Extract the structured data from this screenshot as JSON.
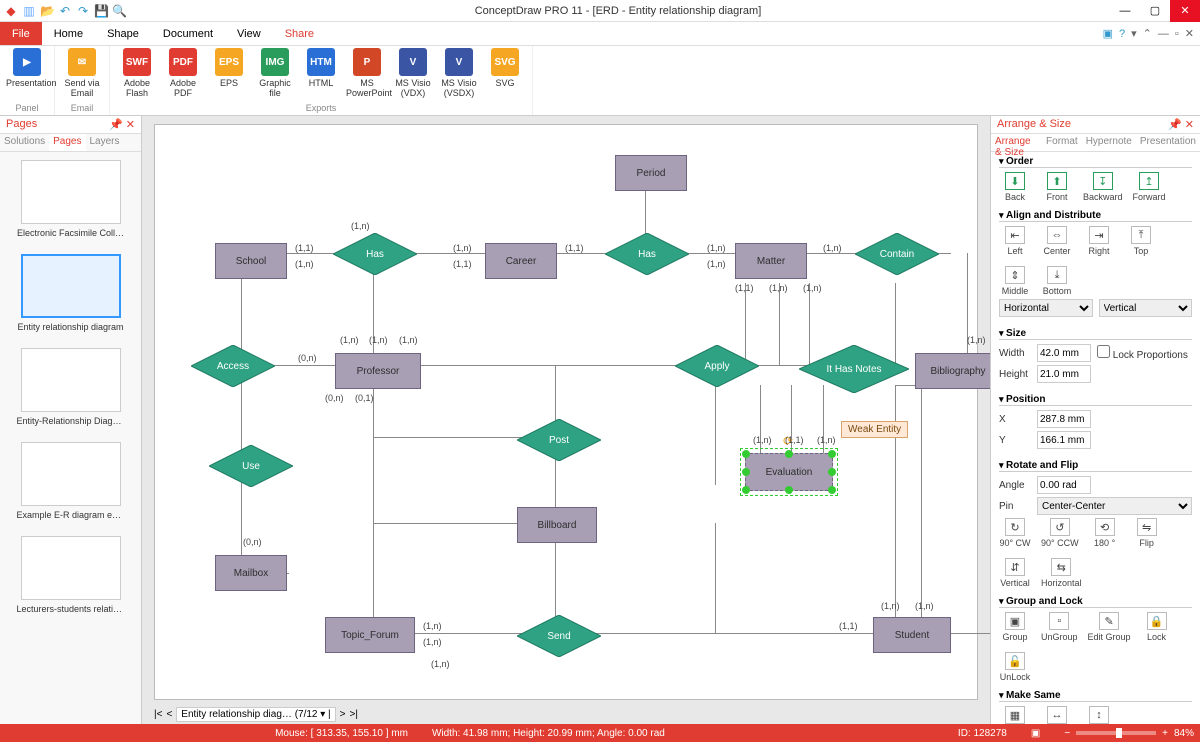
{
  "title": "ConceptDraw PRO 11 - [ERD - Entity relationship diagram]",
  "menu": {
    "file": "File",
    "home": "Home",
    "shape": "Shape",
    "document": "Document",
    "view": "View",
    "share": "Share"
  },
  "ribbon": {
    "groups": {
      "panel": "Panel",
      "email": "Email",
      "exports": "Exports"
    },
    "cmds": {
      "presentation": "Presentation",
      "send_email": "Send via Email",
      "adobe_flash": "Adobe Flash",
      "adobe_pdf": "Adobe PDF",
      "eps": "EPS",
      "graphic": "Graphic file",
      "html": "HTML",
      "ms_ppt": "MS PowerPoint",
      "visio_vdx": "MS Visio (VDX)",
      "visio_vsdx": "MS Visio (VSDX)",
      "svg": "SVG"
    }
  },
  "pages": {
    "header": "Pages",
    "tabs": {
      "solutions": "Solutions",
      "pages": "Pages",
      "layers": "Layers"
    },
    "items": [
      "Electronic Facsimile Coll…",
      "Entity relationship diagram",
      "Entity-Relationship Diagr…",
      "Example E-R diagram ext…",
      "Lecturers-students relatio…"
    ]
  },
  "diagram": {
    "entities": {
      "period": "Period",
      "school": "School",
      "career": "Career",
      "matter": "Matter",
      "professor": "Professor",
      "bibliography": "Bibliography",
      "billboard": "Billboard",
      "mailbox": "Mailbox",
      "topic_forum": "Topic_Forum",
      "student": "Student",
      "evaluation": "Evaluation"
    },
    "relations": {
      "has1": "Has",
      "has2": "Has",
      "contain": "Contain",
      "access": "Access",
      "apply": "Apply",
      "it_has_notes": "It Has Notes",
      "post": "Post",
      "use": "Use",
      "send": "Send"
    },
    "tooltip": "Weak Entity",
    "cards": {
      "c1": "(1,n)",
      "c2": "(1,1)",
      "c3": "(0,n)",
      "c4": "(0,1)"
    }
  },
  "right": {
    "header": "Arrange & Size",
    "tabs": {
      "arrange": "Arrange & Size",
      "format": "Format",
      "hypernote": "Hypernote",
      "presentation": "Presentation"
    },
    "order": {
      "title": "Order",
      "back": "Back",
      "front": "Front",
      "backward": "Backward",
      "forward": "Forward"
    },
    "align": {
      "title": "Align and Distribute",
      "left": "Left",
      "center": "Center",
      "right": "Right",
      "top": "Top",
      "middle": "Middle",
      "bottom": "Bottom",
      "horizontal": "Horizontal",
      "vertical": "Vertical"
    },
    "size": {
      "title": "Size",
      "width_lbl": "Width",
      "height_lbl": "Height",
      "width": "42.0 mm",
      "height": "21.0 mm",
      "lock": "Lock Proportions"
    },
    "position": {
      "title": "Position",
      "x_lbl": "X",
      "y_lbl": "Y",
      "x": "287.8 mm",
      "y": "166.1 mm"
    },
    "rotate": {
      "title": "Rotate and Flip",
      "angle_lbl": "Angle",
      "angle": "0.00 rad",
      "pin_lbl": "Pin",
      "pin": "Center-Center",
      "cw": "90° CW",
      "ccw": "90° CCW",
      "r180": "180 °",
      "flip": "Flip",
      "vert": "Vertical",
      "horz": "Horizontal"
    },
    "group": {
      "title": "Group and Lock",
      "group": "Group",
      "ungroup": "UnGroup",
      "edit": "Edit Group",
      "lock": "Lock",
      "unlock": "UnLock"
    },
    "same": {
      "title": "Make Same",
      "size": "Size",
      "width": "Width",
      "height": "Height"
    }
  },
  "bottom_tabs": {
    "doc": "Entity relationship diag…",
    "page": "(7/12"
  },
  "status": {
    "mouse": "Mouse: [ 313.35, 155.10 ] mm",
    "dims": "Width: 41.98 mm;  Height: 20.99 mm;  Angle: 0.00 rad",
    "id": "ID: 128278",
    "zoom": "84%"
  }
}
